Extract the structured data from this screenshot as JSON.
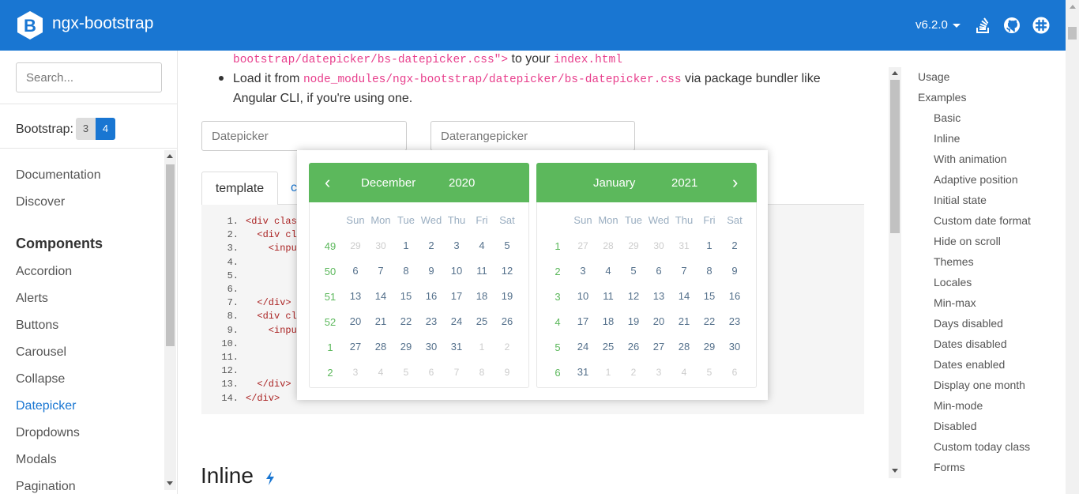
{
  "header": {
    "brand": "ngx-bootstrap",
    "logo_letter": "B",
    "version": "v6.2.0",
    "icons": [
      "stackoverflow-icon",
      "github-icon",
      "slack-icon"
    ],
    "bg_color": "#1976d2"
  },
  "sidebar": {
    "search_placeholder": "Search...",
    "bootstrap_label": "Bootstrap:",
    "bootstrap_versions": [
      "3",
      "4"
    ],
    "active_version": "4",
    "top_links": [
      "Documentation",
      "Discover"
    ],
    "components_heading": "Components",
    "components": [
      "Accordion",
      "Alerts",
      "Buttons",
      "Carousel",
      "Collapse",
      "Datepicker",
      "Dropdowns",
      "Modals",
      "Pagination"
    ],
    "active_component": "Datepicker"
  },
  "main": {
    "line1_code": "bootstrap/datepicker/bs-datepicker.css\">",
    "line1_text": "to your",
    "line1_code2": "index.html",
    "bullet_text_1": "Load it from",
    "bullet_code": "node_modules/ngx-bootstrap/datepicker/bs-datepicker.css",
    "bullet_text_2": "via package bundler like",
    "bullet_text_3": "Angular CLI, if you're using one.",
    "datepicker_placeholder": "Datepicker",
    "daterangepicker_placeholder": "Daterangepicker",
    "tab_template": "template",
    "tab_component_partial": "c",
    "code_lines": [
      {
        "n": "1.",
        "text": "<div clas"
      },
      {
        "n": "2.",
        "text": "  <div cl"
      },
      {
        "n": "3.",
        "text": "    <inpu"
      },
      {
        "n": "4.",
        "text": ""
      },
      {
        "n": "5.",
        "text": ""
      },
      {
        "n": "6.",
        "text": ""
      },
      {
        "n": "7.",
        "text": "  </div>"
      },
      {
        "n": "8.",
        "text": "  <div cl"
      },
      {
        "n": "9.",
        "text": "    <inpu"
      },
      {
        "n": "10.",
        "text": ""
      },
      {
        "n": "11.",
        "text": ""
      },
      {
        "n": "12.",
        "text": ""
      },
      {
        "n": "13.",
        "text": "  </div>"
      },
      {
        "n": "14.",
        "text": "</div>"
      }
    ],
    "inline_heading": "Inline"
  },
  "datepicker": {
    "prev_arrow": "‹",
    "next_arrow": "›",
    "weekdays": [
      "Sun",
      "Mon",
      "Tue",
      "Wed",
      "Thu",
      "Fri",
      "Sat"
    ],
    "accent_color": "#5cb85c",
    "months": [
      {
        "month": "December",
        "year": "2020",
        "weeks": [
          {
            "wk": "49",
            "days": [
              [
                "29",
                1
              ],
              [
                "30",
                1
              ],
              [
                "1",
                0
              ],
              [
                "2",
                0
              ],
              [
                "3",
                0
              ],
              [
                "4",
                0
              ],
              [
                "5",
                0
              ]
            ]
          },
          {
            "wk": "50",
            "days": [
              [
                "6",
                0
              ],
              [
                "7",
                0
              ],
              [
                "8",
                0
              ],
              [
                "9",
                0
              ],
              [
                "10",
                0
              ],
              [
                "11",
                0
              ],
              [
                "12",
                0
              ]
            ]
          },
          {
            "wk": "51",
            "days": [
              [
                "13",
                0
              ],
              [
                "14",
                0
              ],
              [
                "15",
                0
              ],
              [
                "16",
                0
              ],
              [
                "17",
                0
              ],
              [
                "18",
                0
              ],
              [
                "19",
                0
              ]
            ]
          },
          {
            "wk": "52",
            "days": [
              [
                "20",
                0
              ],
              [
                "21",
                0
              ],
              [
                "22",
                0
              ],
              [
                "23",
                0
              ],
              [
                "24",
                0
              ],
              [
                "25",
                0
              ],
              [
                "26",
                0
              ]
            ]
          },
          {
            "wk": "1",
            "days": [
              [
                "27",
                0
              ],
              [
                "28",
                0
              ],
              [
                "29",
                0
              ],
              [
                "30",
                0
              ],
              [
                "31",
                0
              ],
              [
                "1",
                1
              ],
              [
                "2",
                1
              ]
            ]
          },
          {
            "wk": "2",
            "days": [
              [
                "3",
                1
              ],
              [
                "4",
                1
              ],
              [
                "5",
                1
              ],
              [
                "6",
                1
              ],
              [
                "7",
                1
              ],
              [
                "8",
                1
              ],
              [
                "9",
                1
              ]
            ]
          }
        ]
      },
      {
        "month": "January",
        "year": "2021",
        "weeks": [
          {
            "wk": "1",
            "days": [
              [
                "27",
                1
              ],
              [
                "28",
                1
              ],
              [
                "29",
                1
              ],
              [
                "30",
                1
              ],
              [
                "31",
                1
              ],
              [
                "1",
                0
              ],
              [
                "2",
                0
              ]
            ]
          },
          {
            "wk": "2",
            "days": [
              [
                "3",
                0
              ],
              [
                "4",
                0
              ],
              [
                "5",
                0
              ],
              [
                "6",
                0
              ],
              [
                "7",
                0
              ],
              [
                "8",
                0
              ],
              [
                "9",
                0
              ]
            ]
          },
          {
            "wk": "3",
            "days": [
              [
                "10",
                0
              ],
              [
                "11",
                0
              ],
              [
                "12",
                0
              ],
              [
                "13",
                0
              ],
              [
                "14",
                0
              ],
              [
                "15",
                0
              ],
              [
                "16",
                0
              ]
            ]
          },
          {
            "wk": "4",
            "days": [
              [
                "17",
                0
              ],
              [
                "18",
                0
              ],
              [
                "19",
                0
              ],
              [
                "20",
                0
              ],
              [
                "21",
                0
              ],
              [
                "22",
                0
              ],
              [
                "23",
                0
              ]
            ]
          },
          {
            "wk": "5",
            "days": [
              [
                "24",
                0
              ],
              [
                "25",
                0
              ],
              [
                "26",
                0
              ],
              [
                "27",
                0
              ],
              [
                "28",
                0
              ],
              [
                "29",
                0
              ],
              [
                "30",
                0
              ]
            ]
          },
          {
            "wk": "6",
            "days": [
              [
                "31",
                0
              ],
              [
                "1",
                1
              ],
              [
                "2",
                1
              ],
              [
                "3",
                1
              ],
              [
                "4",
                1
              ],
              [
                "5",
                1
              ],
              [
                "6",
                1
              ]
            ]
          }
        ]
      }
    ]
  },
  "toc": {
    "top": [
      "Usage",
      "Examples"
    ],
    "examples": [
      "Basic",
      "Inline",
      "With animation",
      "Adaptive position",
      "Initial state",
      "Custom date format",
      "Hide on scroll",
      "Themes",
      "Locales",
      "Min-max",
      "Days disabled",
      "Dates disabled",
      "Dates enabled",
      "Display one month",
      "Min-mode",
      "Disabled",
      "Custom today class",
      "Forms"
    ]
  }
}
